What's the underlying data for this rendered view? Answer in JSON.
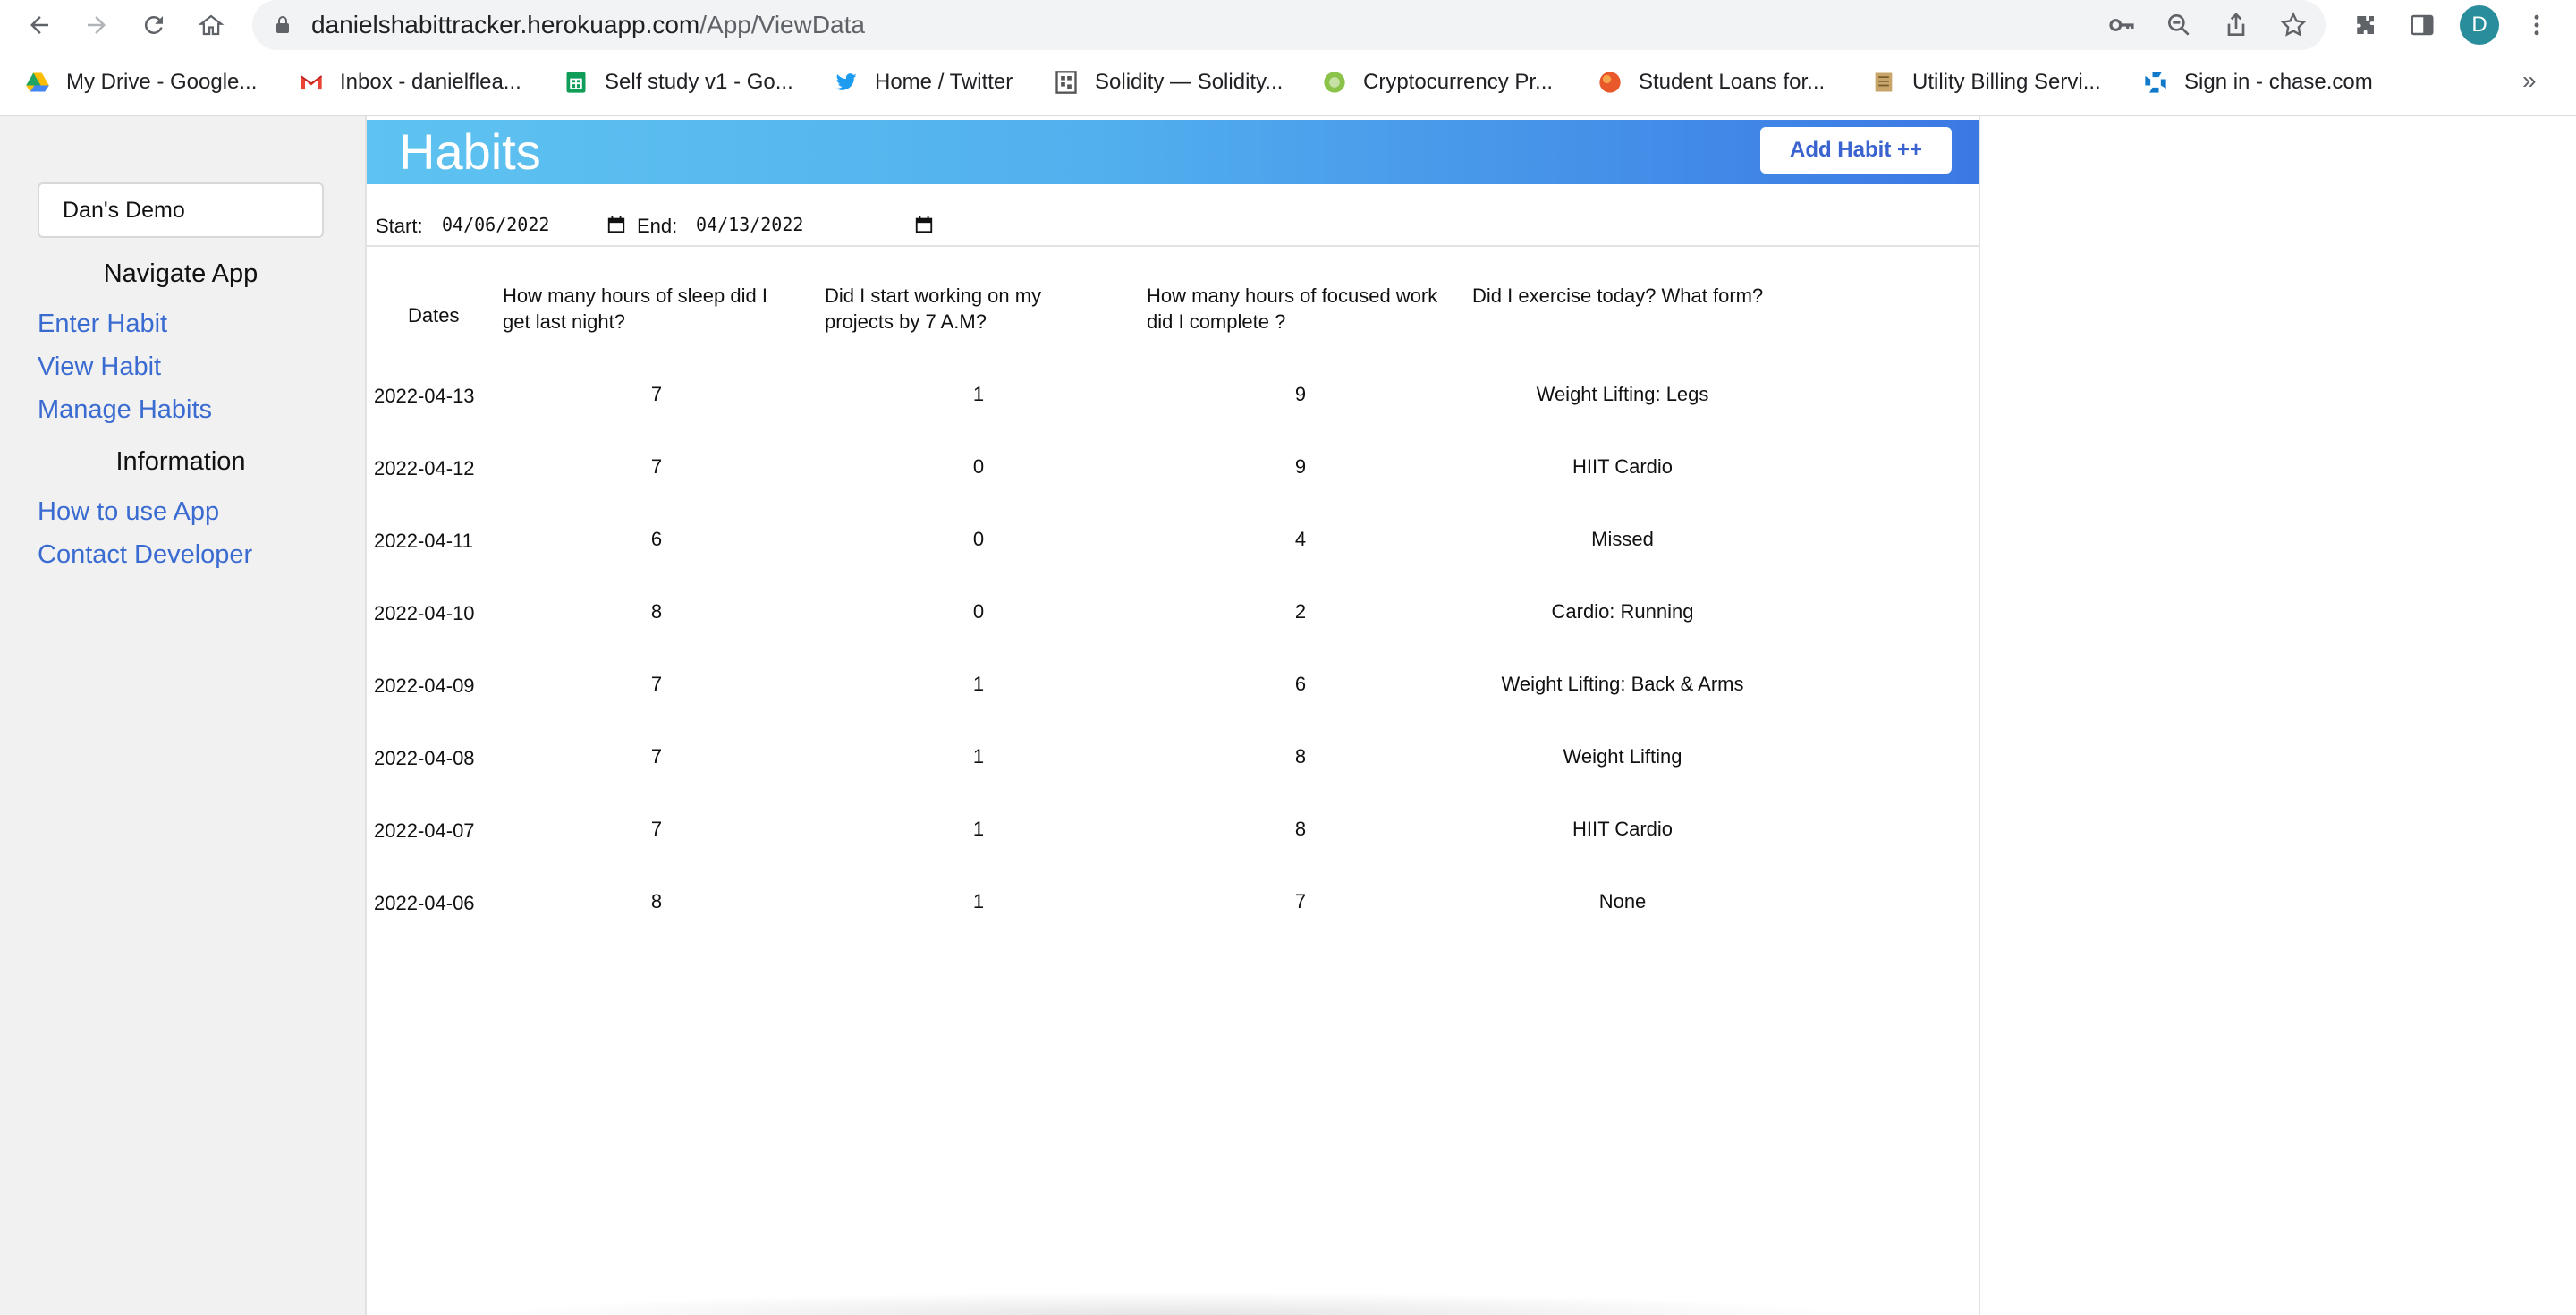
{
  "browser": {
    "url_host": "danielshabittracker.herokuapp.com",
    "url_path": "/App/ViewData",
    "avatar_letter": "D",
    "bookmarks": [
      {
        "label": "My Drive - Google...",
        "icon": "google-drive-icon"
      },
      {
        "label": "Inbox - danielflea...",
        "icon": "gmail-icon"
      },
      {
        "label": "Self study v1 - Go...",
        "icon": "google-sheets-icon"
      },
      {
        "label": "Home / Twitter",
        "icon": "twitter-icon"
      },
      {
        "label": "Solidity — Solidity...",
        "icon": "solidity-icon"
      },
      {
        "label": "Cryptocurrency Pr...",
        "icon": "crypto-icon"
      },
      {
        "label": "Student Loans for...",
        "icon": "student-loans-icon"
      },
      {
        "label": "Utility Billing Servi...",
        "icon": "utility-billing-icon"
      },
      {
        "label": "Sign in - chase.com",
        "icon": "chase-icon"
      }
    ],
    "more_label": "»"
  },
  "sidebar": {
    "user_name": "Dan's Demo",
    "nav_heading": "Navigate App",
    "nav_links": [
      "Enter Habit",
      "View Habit",
      "Manage Habits"
    ],
    "info_heading": "Information",
    "info_links": [
      "How to use App",
      "Contact Developer"
    ]
  },
  "header": {
    "title": "Habits",
    "add_button": "Add Habit ++"
  },
  "filters": {
    "start_label": "Start:",
    "start_value": "04/06/2022",
    "end_label": "End:",
    "end_value": "04/13/2022"
  },
  "table": {
    "columns": [
      "Dates",
      "How many hours of sleep did I get last night?",
      "Did I start working on my projects by 7 A.M?",
      "How many hours of focused work did I complete ?",
      "Did I exercise today? What form?"
    ],
    "rows": [
      [
        "2022-04-13",
        "7",
        "1",
        "9",
        "Weight Lifting: Legs"
      ],
      [
        "2022-04-12",
        "7",
        "0",
        "9",
        "HIIT Cardio"
      ],
      [
        "2022-04-11",
        "6",
        "0",
        "4",
        "Missed"
      ],
      [
        "2022-04-10",
        "8",
        "0",
        "2",
        "Cardio: Running"
      ],
      [
        "2022-04-09",
        "7",
        "1",
        "6",
        "Weight Lifting: Back & Arms"
      ],
      [
        "2022-04-08",
        "7",
        "1",
        "8",
        "Weight Lifting"
      ],
      [
        "2022-04-07",
        "7",
        "1",
        "8",
        "HIIT Cardio"
      ],
      [
        "2022-04-06",
        "8",
        "1",
        "7",
        "None"
      ]
    ]
  }
}
